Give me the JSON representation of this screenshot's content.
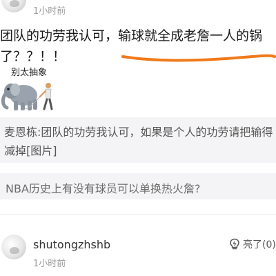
{
  "post": {
    "time": "1小时前",
    "text_line1": "团队的功劳我认可，输球就全成老詹一人的锅",
    "text_line2": "了？？！！",
    "meme_caption": "别太抽象",
    "meme_icon": "elephant-emoji"
  },
  "quote": {
    "author": "麦恩栋",
    "text": "团队的功劳我认可，如果是个人的功劳请把输得减掉[图片]"
  },
  "topic": {
    "text": "NBA历史上有没有球员可以单换热火詹?"
  },
  "comment": {
    "username": "shutongzhshb",
    "time": "1小时前",
    "like_label": "亮了(0)",
    "like_icon": "lightbulb-icon"
  },
  "colors": {
    "underline": "#f07a1a",
    "muted": "#9a9a9a",
    "card_bg": "#f4f4f6"
  }
}
